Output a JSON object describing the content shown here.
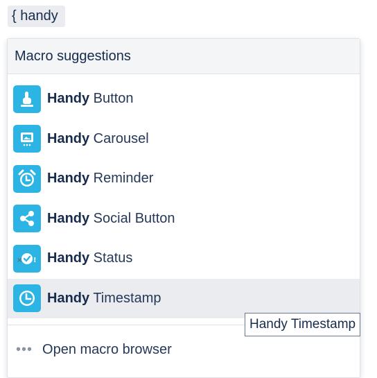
{
  "query": "{ handy",
  "dropdown": {
    "header": "Macro suggestions",
    "items": [
      {
        "bold": "Handy",
        "rest": " Button",
        "icon": "pointing-hand-icon"
      },
      {
        "bold": "Handy",
        "rest": " Carousel",
        "icon": "image-carousel-icon"
      },
      {
        "bold": "Handy",
        "rest": " Reminder",
        "icon": "alarm-clock-icon"
      },
      {
        "bold": "Handy",
        "rest": " Social Button",
        "icon": "share-icon"
      },
      {
        "bold": "Handy",
        "rest": " Status",
        "icon": "status-check-icon"
      },
      {
        "bold": "Handy",
        "rest": " Timestamp",
        "icon": "clock-icon"
      }
    ],
    "active_index": 5,
    "browser_link": "Open macro browser",
    "browser_icon": "ellipsis-icon"
  },
  "tooltip": "Handy Timestamp",
  "colors": {
    "icon_bg": "#2bb4e4",
    "active_row": "#ebecf0",
    "header_bg": "#f4f5f7",
    "text": "#172b4d"
  }
}
